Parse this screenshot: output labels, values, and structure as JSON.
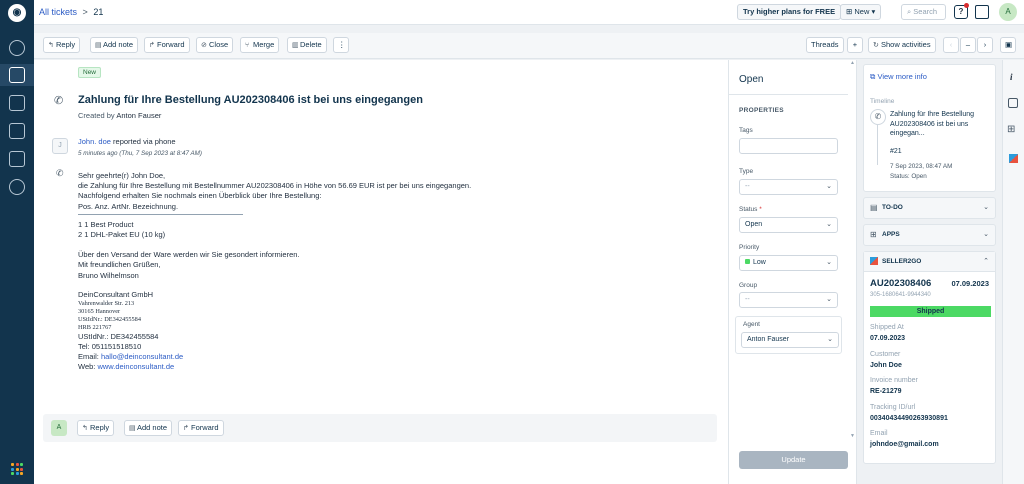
{
  "header": {
    "breadcrumb_link": "All tickets",
    "breadcrumb_sep": ">",
    "ticket_number": "21",
    "try_plans": "Try higher plans for FREE",
    "new_button": "New",
    "search_placeholder": "Search",
    "avatar_initial": "A"
  },
  "toolbar": {
    "reply": "Reply",
    "add_note": "Add note",
    "forward": "Forward",
    "close": "Close",
    "merge": "Merge",
    "delete": "Delete",
    "more": "⋮",
    "threads": "Threads",
    "threads_add": "+",
    "show_activities": "Show activities"
  },
  "ticket": {
    "status_badge": "New",
    "subject": "Zahlung für Ihre Bestellung AU202308406 ist bei uns eingegangen",
    "created_by_label": "Created by",
    "created_by": "Anton Fauser",
    "requester": "John. doe",
    "reported_via": "reported via phone",
    "avatar_initial": "J",
    "time": "5 minutes ago (Thu, 7 Sep 2023 at 8:47 AM)",
    "body": [
      "Sehr geehrte(r) John Doe,",
      "die Zahlung für Ihre Bestellung mit Bestellnummer AU202308406 in Höhe von 56.69 EUR ist per bei uns eingegangen.",
      "Nachfolgend erhalten Sie nochmals einen Überblick über Ihre Bestellung:",
      "Pos. Anz. ArtNr.     Bezeichnung."
    ],
    "items": [
      "1 1      Best Product",
      "2 1      DHL-Paket EU (10 kg)"
    ],
    "closing": [
      "Über den Versand der Ware werden wir Sie gesondert informieren.",
      "Mit freundlichen Grüßen,",
      "Bruno Wilhelmson"
    ],
    "company": "DeinConsultant GmbH",
    "address": [
      "Vahrenwalder Str. 213",
      "30165 Hannover",
      "UStIdNr.: DE342455584",
      "HRB 221767"
    ],
    "vat": "UStIdNr.: DE342455584",
    "tel": "Tel:  051151518510",
    "email_label": "Email:",
    "email": "hallo@deinconsultant.de",
    "web_label": "Web:",
    "web": "www.deinconsultant.de"
  },
  "reply_bar": {
    "avatar_initial": "A",
    "reply": "Reply",
    "add_note": "Add note",
    "forward": "Forward"
  },
  "properties": {
    "status_heading": "Open",
    "section_title": "PROPERTIES",
    "tags_label": "Tags",
    "type_label": "Type",
    "type_value": "--",
    "status_label": "Status",
    "required_mark": "*",
    "status_value": "Open",
    "priority_label": "Priority",
    "priority_value": "Low",
    "group_label": "Group",
    "group_value": "--",
    "agent_label": "Agent",
    "agent_value": "Anton Fauser",
    "update_button": "Update"
  },
  "contact": {
    "view_more": "View more info",
    "timeline_label": "Timeline",
    "timeline_title": "Zahlung für Ihre Bestellung AU202308406 ist bei uns eingegan...",
    "timeline_id": "#21",
    "timeline_time": "7 Sep 2023, 08:47 AM",
    "timeline_status": "Status: Open"
  },
  "sections": {
    "todo": "TO-DO",
    "apps": "APPS",
    "seller": "SELLER2GO"
  },
  "order": {
    "number": "AU202308406",
    "date": "07.09.2023",
    "sub_id": "305-1680641-9944340",
    "status": "Shipped",
    "shipped_at_label": "Shipped At",
    "shipped_at": "07.09.2023",
    "customer_label": "Customer",
    "customer": "John Doe",
    "invoice_label": "Invoice number",
    "invoice": "RE-21279",
    "tracking_label": "Tracking ID/url",
    "tracking": "00340434490263930891",
    "email_label": "Email",
    "email": "johndoe@gmail.com"
  },
  "colors": {
    "nav_bg": "#12344d",
    "shipped_bg": "#4cd964",
    "link": "#2c5cc5",
    "priority_low": "#4cd964",
    "required": "#d72d30"
  },
  "icons": [
    "freshdesk-logo",
    "dashboard-icon",
    "tickets-icon",
    "contacts-icon",
    "knowledge-base-icon",
    "reports-icon",
    "admin-gear-icon",
    "apps-grid-icon",
    "help-icon",
    "marketplace-icon",
    "info-icon",
    "calendar-icon",
    "apps-icon",
    "seller2go-icon"
  ]
}
